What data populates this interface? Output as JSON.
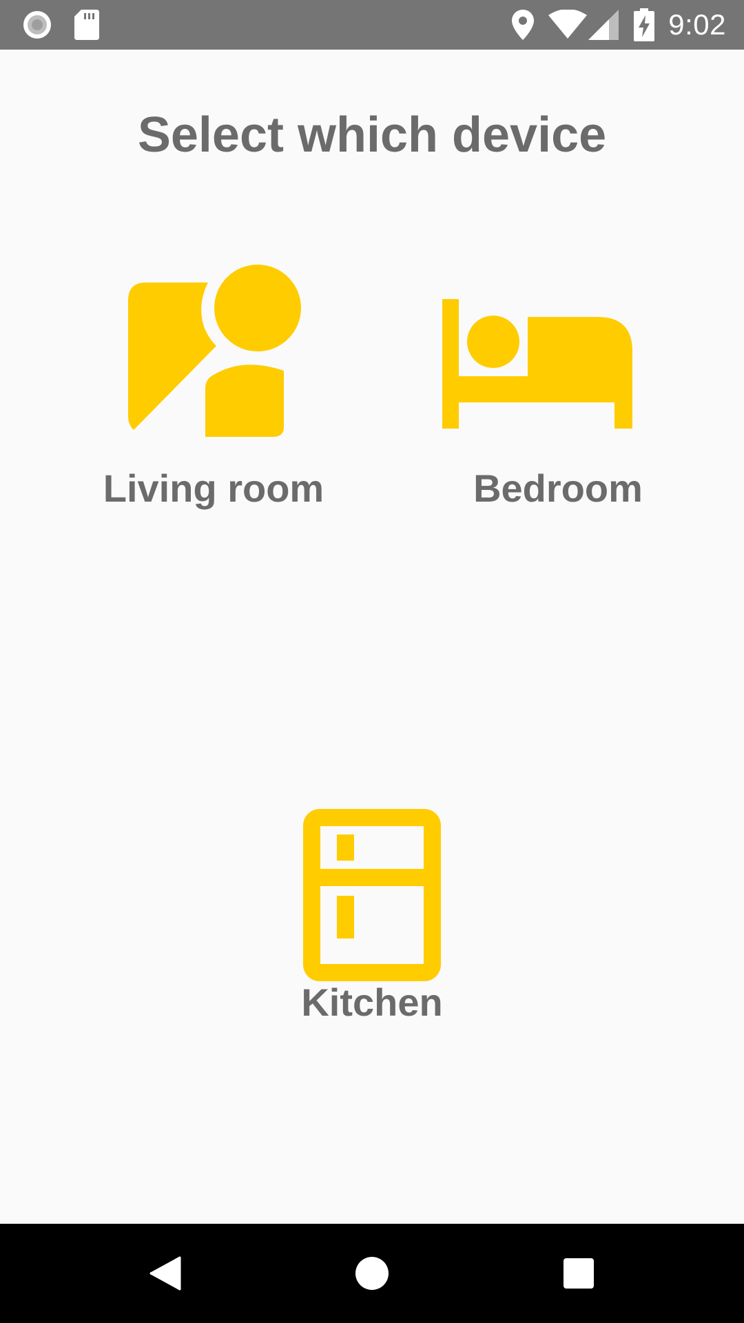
{
  "status_bar": {
    "time": "9:02",
    "icons": [
      "record-icon",
      "sd-card-icon",
      "location-icon",
      "wifi-icon",
      "cell-signal-icon",
      "battery-charging-icon"
    ]
  },
  "page": {
    "title": "Select which device"
  },
  "rooms": [
    {
      "label": "Living room",
      "icon": "living-room-icon"
    },
    {
      "label": "Bedroom",
      "icon": "bed-icon"
    },
    {
      "label": "Kitchen",
      "icon": "fridge-icon"
    }
  ],
  "colors": {
    "accent": "#FFCC00",
    "text": "#6B6B6B",
    "status_bar": "#757575",
    "background": "#FAFAFA",
    "nav_bar": "#000000"
  },
  "nav_bar": {
    "buttons": [
      "back-icon",
      "home-icon",
      "recents-icon"
    ]
  }
}
